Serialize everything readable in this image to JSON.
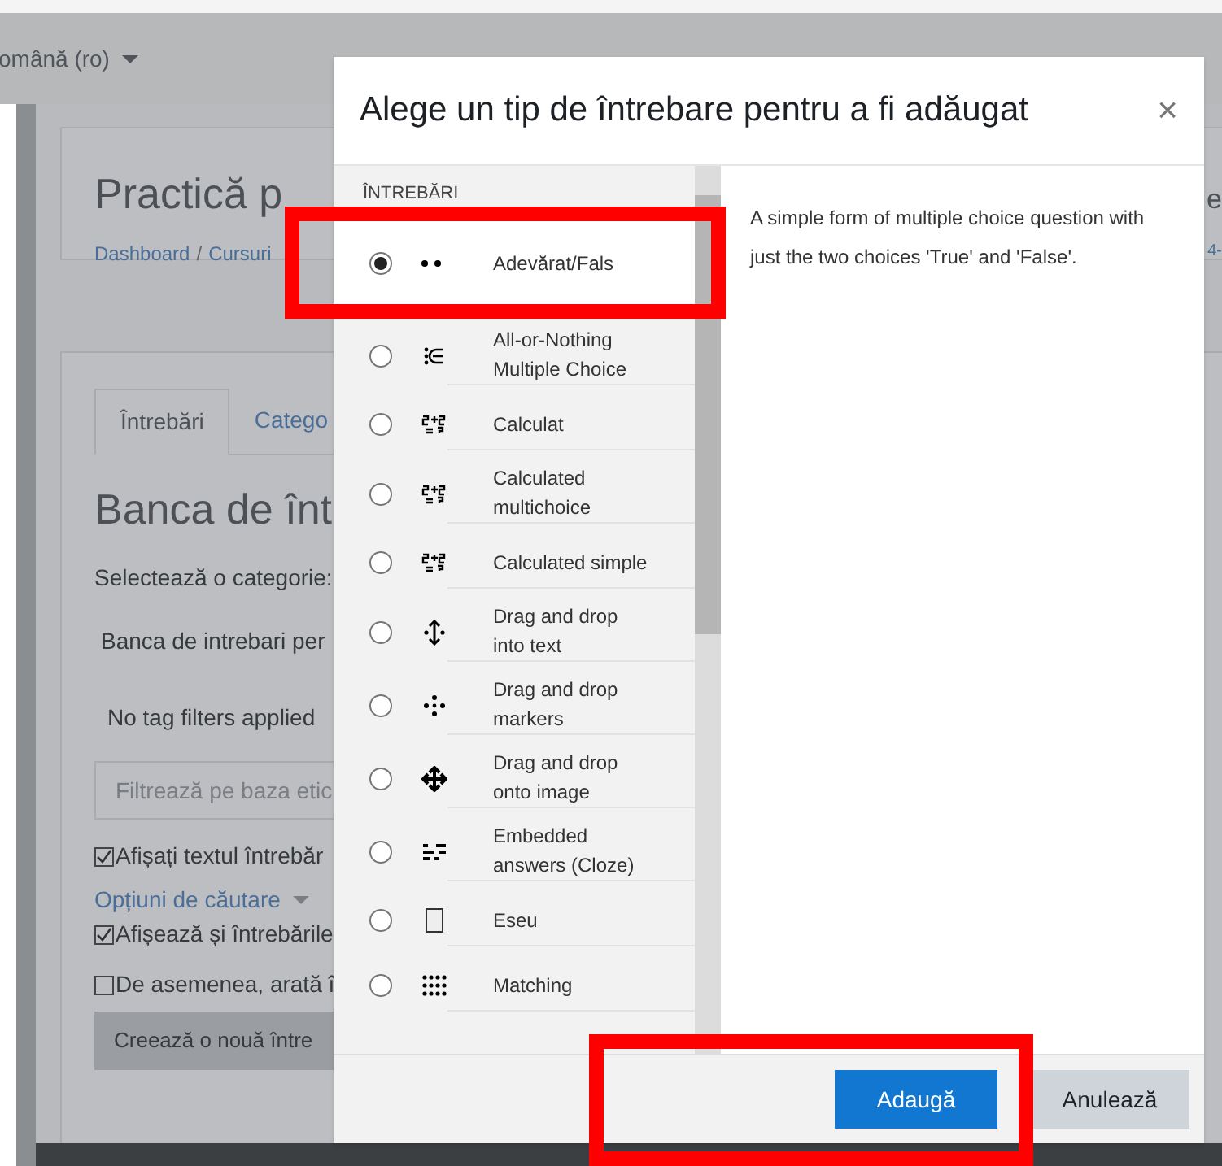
{
  "background_page": {
    "language_menu": "omână (ro)",
    "page_title": "Practică p",
    "breadcrumbs": [
      {
        "label": "Dashboard"
      },
      {
        "label": "Cursuri"
      }
    ],
    "breadcrumb_separator": "/",
    "title_end": "e",
    "breadcrumb_end": "4-",
    "tabs": [
      {
        "label": "Întrebări",
        "selected": true
      },
      {
        "label": "Catego",
        "selected": false
      }
    ],
    "bank_heading": "Banca de înt",
    "category_label": "Selectează o categorie:",
    "category_value": "Banca de intrebari per",
    "tag_filters": "No tag filters applied",
    "tag_filter_field": {
      "placeholder": "Filtrează pe baza etic"
    },
    "checkbox_show_text": {
      "label": "Afișați textul întrebăr",
      "checked": true
    },
    "search_options": "Opțiuni de căutare",
    "checkbox_subcategories": {
      "label": "Afișează și întrebările",
      "checked": true
    },
    "checkbox_old": {
      "label": "De asemenea, arată î",
      "checked": false
    },
    "create_button": "Creează o nouă între"
  },
  "dialog": {
    "title": "Alege un tip de întrebare pentru a fi adăugat",
    "close": "×",
    "list_heading": "ÎNTREBĂRI",
    "question_types": [
      {
        "label": "Adevărat/Fals",
        "kind": "truefalse",
        "selected": true
      },
      {
        "label": "All-or-Nothing Multiple Choice",
        "kind": "multichoice",
        "selected": false
      },
      {
        "label": "Calculat",
        "kind": "calc",
        "selected": false
      },
      {
        "label": "Calculated multichoice",
        "kind": "calc",
        "selected": false
      },
      {
        "label": "Calculated simple",
        "kind": "calc",
        "selected": false
      },
      {
        "label": "Drag and drop into text",
        "kind": "ddtext",
        "selected": false
      },
      {
        "label": "Drag and drop markers",
        "kind": "ddmarker",
        "selected": false
      },
      {
        "label": "Drag and drop onto image",
        "kind": "ddimage",
        "selected": false
      },
      {
        "label": "Embedded answers (Cloze)",
        "kind": "cloze",
        "selected": false
      },
      {
        "label": "Eseu",
        "kind": "essay",
        "selected": false
      },
      {
        "label": "Matching",
        "kind": "match",
        "selected": false
      }
    ],
    "description": "A simple form of multiple choice question with just the two choices 'True' and 'False'.",
    "buttons": [
      {
        "label": "Adaugă",
        "kind": "primary"
      },
      {
        "label": "Anulează",
        "kind": "secondary"
      }
    ]
  }
}
